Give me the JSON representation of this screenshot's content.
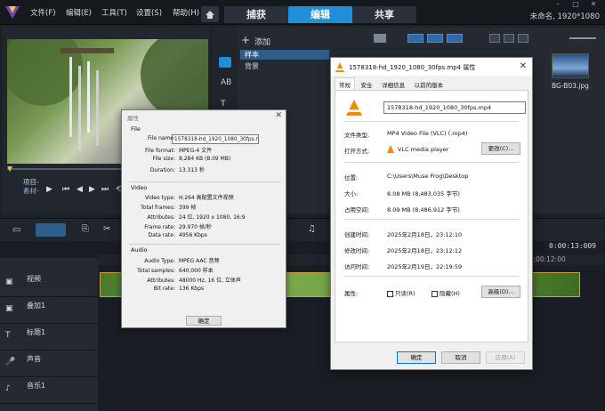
{
  "app": {
    "project_name": "未命名, 1920*1080",
    "menus": [
      "文件(F)",
      "编辑(E)",
      "工具(T)",
      "设置(S)",
      "帮助(H)"
    ],
    "tabs": [
      "捕获",
      "编辑",
      "共享"
    ],
    "active_tab": "编辑"
  },
  "player": {
    "project_label": "项目-",
    "clip_label": "素材-"
  },
  "library": {
    "add_label": "添加",
    "tree": [
      "样本",
      "背景"
    ],
    "thumb_label": "BG-B03.jpg"
  },
  "timeline": {
    "timecode": "0:00:13:009",
    "ruler_label": "00:00:12:00",
    "tracks": [
      "视频",
      "叠加1",
      "标题1",
      "声音",
      "音乐1"
    ]
  },
  "props_dialog": {
    "title": "属性",
    "file_group": "File",
    "video_group": "Video",
    "audio_group": "Audio",
    "file_rows": [
      {
        "k": "File name:",
        "v": "1578318-hd_1920_1080_30fps.mp4"
      },
      {
        "k": "File format:",
        "v": "MPEG-4 文件"
      },
      {
        "k": "File size:",
        "v": "8,284 KB (8.09 MB)"
      },
      {
        "k": "Duration:",
        "v": "13.313 秒"
      }
    ],
    "video_rows": [
      {
        "k": "Video type:",
        "v": "H.264 高配置文件视频"
      },
      {
        "k": "Total frames:",
        "v": "399 帧"
      },
      {
        "k": "Attributes:",
        "v": "24 位, 1920 x 1080, 16:9"
      },
      {
        "k": "Frame rate:",
        "v": "29.970 帧/秒"
      },
      {
        "k": "Data rate:",
        "v": "4956 Kbps"
      }
    ],
    "audio_rows": [
      {
        "k": "Audio Type:",
        "v": "MPEG AAC 音频"
      },
      {
        "k": "Total samples:",
        "v": "640,000 样本"
      },
      {
        "k": "Attributes:",
        "v": "48000 Hz, 16 位, 立体声"
      },
      {
        "k": "Bit rate:",
        "v": "136 Kbps"
      }
    ],
    "ok": "确定"
  },
  "file_dialog": {
    "title": "1578318-hd_1920_1080_30fps.mp4 属性",
    "tabs": [
      "常规",
      "安全",
      "详细信息",
      "以前的版本"
    ],
    "filename": "1578318-hd_1920_1080_30fps.mp4",
    "type_label": "文件类型:",
    "type_value": "MP4 Video File (VLC) (.mp4)",
    "open_label": "打开方式:",
    "open_value": "VLC media player",
    "change_btn": "更改(C)...",
    "loc_label": "位置:",
    "loc_value": "C:\\Users\\Muse Frog\\Desktop",
    "size_label": "大小:",
    "size_value": "8.08 MB (8,483,035 字节)",
    "disk_label": "占用空间:",
    "disk_value": "8.09 MB (8,486,912 字节)",
    "created_label": "创建时间:",
    "created_value": "2025年2月18日，23:12:10",
    "modified_label": "修改时间:",
    "modified_value": "2025年2月18日，23:12:12",
    "accessed_label": "访问时间:",
    "accessed_value": "2025年2月19日，22:19:59",
    "attr_label": "属性:",
    "readonly": "只读(R)",
    "hidden": "隐藏(H)",
    "advanced": "高级(D)...",
    "ok": "确定",
    "cancel": "取消",
    "apply": "应用(A)"
  }
}
